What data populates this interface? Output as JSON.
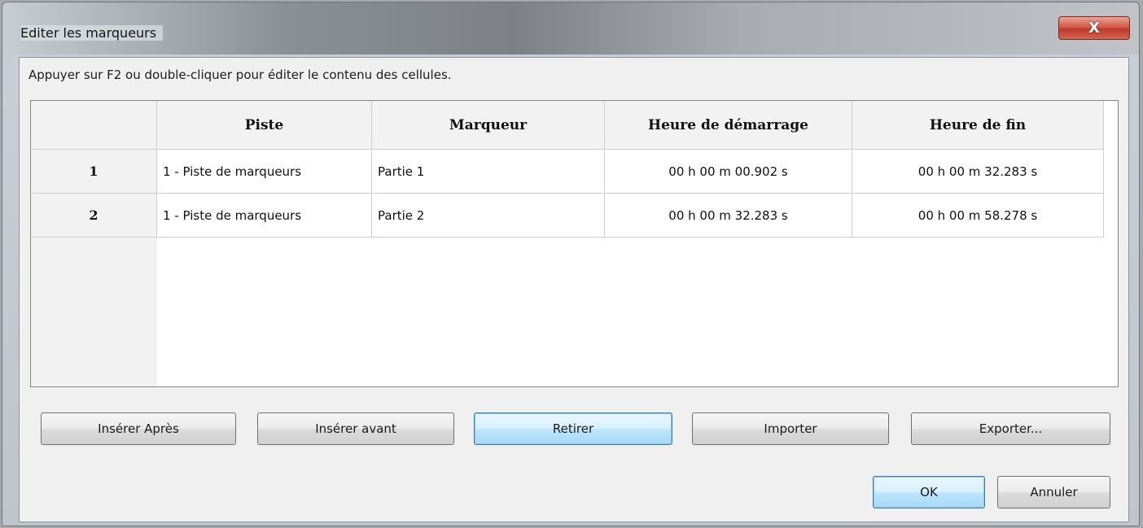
{
  "window": {
    "title": "Editer les marqueurs",
    "close_label": "X"
  },
  "hint": "Appuyer sur F2 ou double-cliquer pour éditer le contenu des cellules.",
  "table": {
    "columns": [
      "",
      "Piste",
      "Marqueur",
      "Heure de démarrage",
      "Heure de fin"
    ],
    "rows": [
      {
        "num": "1",
        "piste": "1 - Piste de marqueurs",
        "marqueur": "Partie 1",
        "debut": "00 h 00 m 00.902 s",
        "fin": "00 h 00 m 32.283 s"
      },
      {
        "num": "2",
        "piste": "1 - Piste de marqueurs",
        "marqueur": "Partie 2",
        "debut": "00 h 00 m 32.283 s",
        "fin": "00 h 00 m 58.278 s"
      }
    ]
  },
  "buttons": {
    "insert_after": "Insérer Après",
    "insert_before": "Insérer avant",
    "remove": "Retirer",
    "import": "Importer",
    "export": "Exporter...",
    "ok": "OK",
    "cancel": "Annuler"
  }
}
